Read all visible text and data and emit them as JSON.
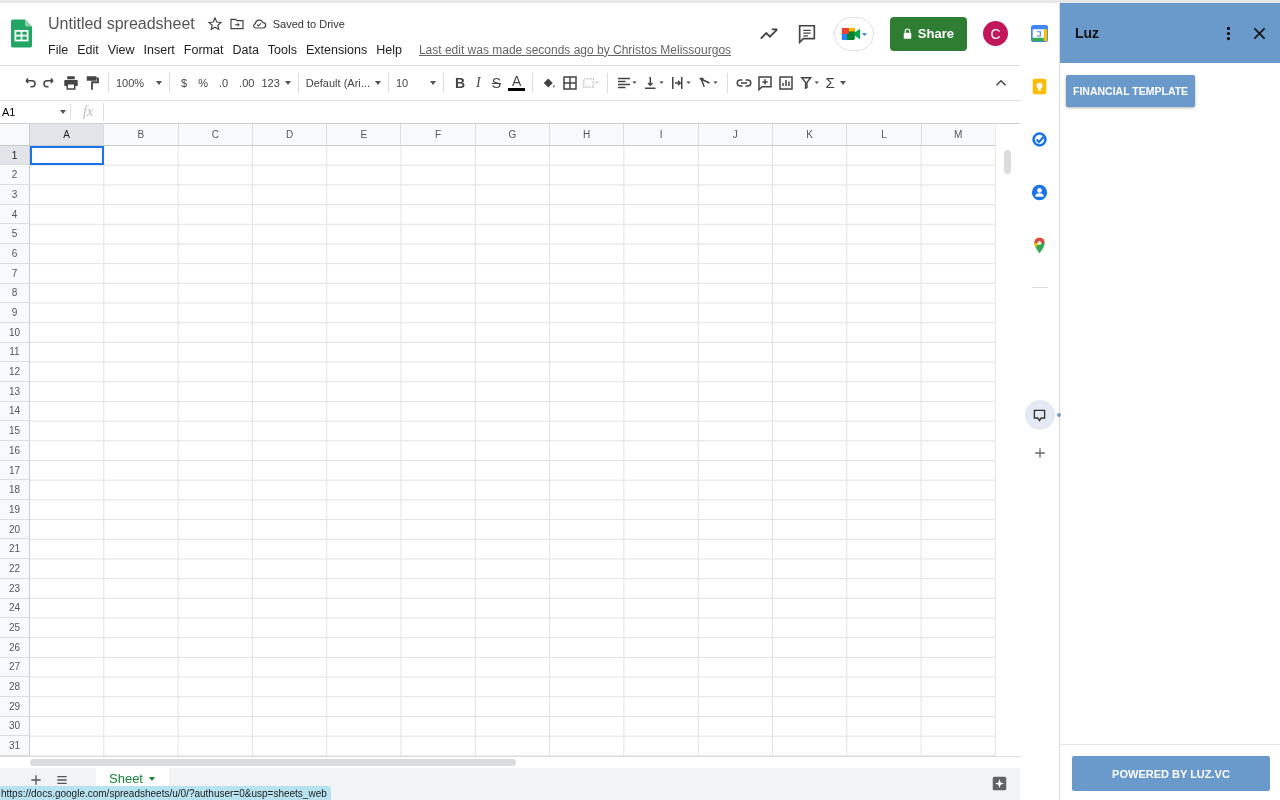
{
  "document": {
    "title": "Untitled spreadsheet",
    "save_status": "Saved to Drive",
    "last_edit": "Last edit was made seconds ago by Christos Melissourgos"
  },
  "menu": [
    "File",
    "Edit",
    "View",
    "Insert",
    "Format",
    "Data",
    "Tools",
    "Extensions",
    "Help"
  ],
  "share_button": "Share",
  "avatar": "C",
  "toolbar": {
    "zoom": "100%",
    "currency": "$",
    "percent": "%",
    "decrease_decimals": ".0",
    "increase_decimals": ".00",
    "number_format": "123",
    "font": "Default (Ari...",
    "font_size": "10",
    "bold": "B",
    "italic": "I",
    "strikethrough": "S",
    "text_color": "A",
    "sum": "Σ"
  },
  "name_box": "A1",
  "formula_label": "fx",
  "columns": [
    {
      "label": "A",
      "selected": true
    },
    {
      "label": "B",
      "selected": false
    },
    {
      "label": "C",
      "selected": false
    },
    {
      "label": "D",
      "selected": false
    },
    {
      "label": "E",
      "selected": false
    },
    {
      "label": "F",
      "selected": false
    },
    {
      "label": "G",
      "selected": false
    },
    {
      "label": "H",
      "selected": false
    },
    {
      "label": "I",
      "selected": false
    },
    {
      "label": "J",
      "selected": false
    },
    {
      "label": "K",
      "selected": false
    },
    {
      "label": "L",
      "selected": false
    },
    {
      "label": "M",
      "selected": false
    }
  ],
  "rows": [
    {
      "label": "1",
      "selected": true
    },
    {
      "label": "2",
      "selected": false
    },
    {
      "label": "3",
      "selected": false
    },
    {
      "label": "4",
      "selected": false
    },
    {
      "label": "5",
      "selected": false
    },
    {
      "label": "6",
      "selected": false
    },
    {
      "label": "7",
      "selected": false
    },
    {
      "label": "8",
      "selected": false
    },
    {
      "label": "9",
      "selected": false
    },
    {
      "label": "10",
      "selected": false
    },
    {
      "label": "11",
      "selected": false
    },
    {
      "label": "12",
      "selected": false
    },
    {
      "label": "13",
      "selected": false
    },
    {
      "label": "14",
      "selected": false
    },
    {
      "label": "15",
      "selected": false
    },
    {
      "label": "16",
      "selected": false
    },
    {
      "label": "17",
      "selected": false
    },
    {
      "label": "18",
      "selected": false
    },
    {
      "label": "19",
      "selected": false
    },
    {
      "label": "20",
      "selected": false
    },
    {
      "label": "21",
      "selected": false
    },
    {
      "label": "22",
      "selected": false
    },
    {
      "label": "23",
      "selected": false
    },
    {
      "label": "24",
      "selected": false
    },
    {
      "label": "25",
      "selected": false
    },
    {
      "label": "26",
      "selected": false
    },
    {
      "label": "27",
      "selected": false
    },
    {
      "label": "28",
      "selected": false
    },
    {
      "label": "29",
      "selected": false
    },
    {
      "label": "30",
      "selected": false
    },
    {
      "label": "31",
      "selected": false
    }
  ],
  "side_apps": [
    {
      "kind": "calendar",
      "selected": false
    },
    {
      "kind": "keep",
      "selected": false
    },
    {
      "kind": "tasks",
      "selected": false
    },
    {
      "kind": "contacts",
      "selected": false
    },
    {
      "kind": "maps",
      "selected": false
    },
    {
      "kind": "addon",
      "selected": true
    }
  ],
  "sheet_tabs": [
    {
      "label": "Sheet",
      "selected": true
    }
  ],
  "status_url": "https://docs.google.com/spreadsheets/u/0/?authuser=0&usp=sheets_web",
  "addon_panel": {
    "title": "Luz",
    "action_button": "FINANCIAL TEMPLATE",
    "footer_button": "POWERED BY LUZ.VC"
  }
}
